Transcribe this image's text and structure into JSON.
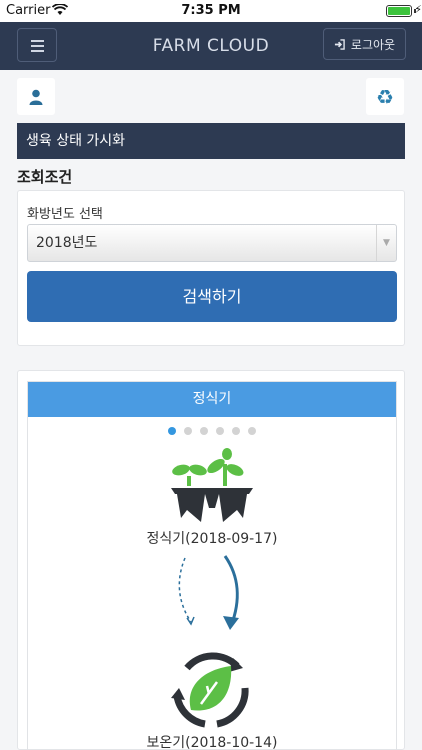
{
  "status": {
    "carrier": "Carrier",
    "time": "7:35 PM"
  },
  "navbar": {
    "brand": "FARM CLOUD",
    "logout_label": "로그아웃"
  },
  "section": {
    "title": "생육 상태 가시화"
  },
  "search": {
    "conditions_title": "조회조건",
    "year_label": "화방년도 선택",
    "year_value": "2018년도",
    "button_label": "검색하기"
  },
  "stage": {
    "title": "정식기",
    "dots_total": 6,
    "active_dot": 0,
    "step1_label": "정식기(2018-09-17)",
    "step2_label": "보온기(2018-10-14)"
  },
  "colors": {
    "navy": "#2d3a52",
    "primary_button": "#2f6db3",
    "stage_header": "#4a9be2",
    "leaf_green": "#5cbf46",
    "arrow_blue": "#2b6f9b"
  },
  "icons": {
    "menu": "hamburger-icon",
    "logout": "sign-in-icon",
    "user": "user-icon",
    "recycle": "recycle-icon",
    "stage1": "seedling-tray-icon",
    "stage2": "leaf-cycle-icon"
  }
}
